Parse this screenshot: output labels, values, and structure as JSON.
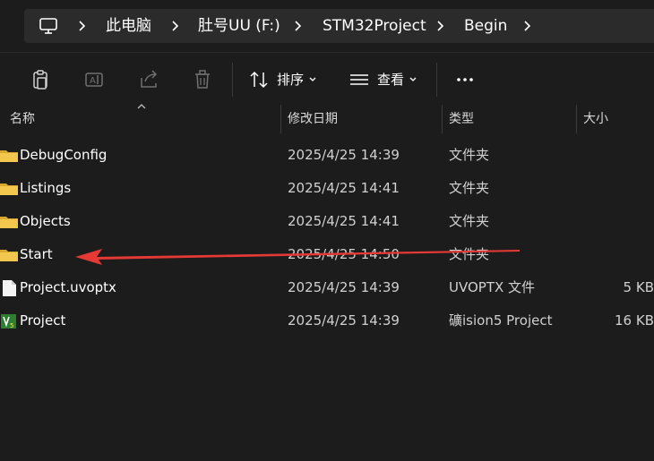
{
  "breadcrumb": {
    "items": [
      "此电脑",
      "肚号UU (F:)",
      "STM32Project",
      "Begin"
    ]
  },
  "toolbar": {
    "sort_label": "排序",
    "view_label": "查看"
  },
  "columns": {
    "name": "名称",
    "modified": "修改日期",
    "type": "类型",
    "size": "大小"
  },
  "files": [
    {
      "icon": "folder-icon",
      "name": "DebugConfig",
      "modified": "2025/4/25 14:39",
      "type": "文件夹",
      "size": ""
    },
    {
      "icon": "folder-icon",
      "name": "Listings",
      "modified": "2025/4/25 14:41",
      "type": "文件夹",
      "size": ""
    },
    {
      "icon": "folder-icon",
      "name": "Objects",
      "modified": "2025/4/25 14:41",
      "type": "文件夹",
      "size": ""
    },
    {
      "icon": "folder-icon",
      "name": "Start",
      "modified": "2025/4/25 14:50",
      "type": "文件夹",
      "size": ""
    },
    {
      "icon": "file-icon",
      "name": "Project.uvoptx",
      "modified": "2025/4/25 14:39",
      "type": "UVOPTX 文件",
      "size": "5 KB"
    },
    {
      "icon": "keil-project-icon",
      "name": "Project",
      "modified": "2025/4/25 14:39",
      "type": "礦ision5 Project",
      "size": "16 KB"
    }
  ],
  "colors": {
    "background": "#1c1c1c",
    "address_bar": "#2b2b2b",
    "folder": "#f0c244",
    "annotation_arrow": "#e53935"
  }
}
